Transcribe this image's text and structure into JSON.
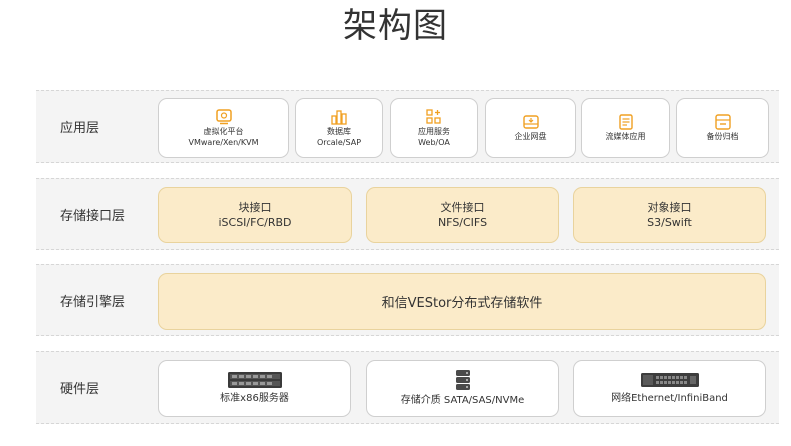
{
  "title": "架构图",
  "layers": {
    "app": {
      "label": "应用层",
      "items": [
        {
          "name": "虚拟化平台",
          "sub": "VMware/Xen/KVM",
          "icon": "monitor-icon"
        },
        {
          "name": "数据库",
          "sub": "Orcale/SAP",
          "icon": "database-bars-icon"
        },
        {
          "name": "应用服务",
          "sub": "Web/OA",
          "icon": "app-grid-icon"
        },
        {
          "name": "企业网盘",
          "sub": "",
          "icon": "cloud-drive-icon"
        },
        {
          "name": "流媒体应用",
          "sub": "",
          "icon": "media-icon"
        },
        {
          "name": "备份归档",
          "sub": "",
          "icon": "archive-icon"
        }
      ]
    },
    "interface": {
      "label": "存储接口层",
      "items": [
        {
          "name": "块接口",
          "sub": "iSCSI/FC/RBD"
        },
        {
          "name": "文件接口",
          "sub": "NFS/CIFS"
        },
        {
          "name": "对象接口",
          "sub": "S3/Swift"
        }
      ]
    },
    "engine": {
      "label": "存储引擎层",
      "name": "和信VEStor分布式存储软件"
    },
    "hardware": {
      "label": "硬件层",
      "items": [
        {
          "name": "标准x86服务器",
          "icon": "server-icon"
        },
        {
          "name": "存储介质 SATA/SAS/NVMe",
          "icon": "disk-stack-icon"
        },
        {
          "name": "网络Ethernet/InfiniBand",
          "icon": "network-switch-icon"
        }
      ]
    }
  },
  "colors": {
    "accent": "#f0a022",
    "cream": "#fbebc9",
    "layer_bg": "#f4f4f4"
  }
}
